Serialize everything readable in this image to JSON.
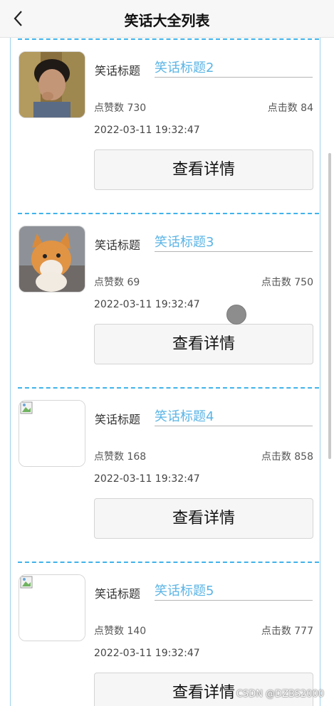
{
  "header": {
    "title": "笑话大全列表",
    "back_icon": "chevron-left-icon"
  },
  "list": {
    "items": [
      {
        "title_label": "笑话标题",
        "title": "笑话标题2",
        "likes": "点赞数 730",
        "clicks": "点击数 84",
        "date": "2022-03-11 19:32:47",
        "button": "查看详情",
        "image": "boy-photo"
      },
      {
        "title_label": "笑话标题",
        "title": "笑话标题3",
        "likes": "点赞数 69",
        "clicks": "点击数 750",
        "date": "2022-03-11 19:32:47",
        "button": "查看详情",
        "image": "cat-photo"
      },
      {
        "title_label": "笑话标题",
        "title": "笑话标题4",
        "likes": "点赞数 168",
        "clicks": "点击数 858",
        "date": "2022-03-11 19:32:47",
        "button": "查看详情",
        "image": "broken-image-icon"
      },
      {
        "title_label": "笑话标题",
        "title": "笑话标题5",
        "likes": "点赞数 140",
        "clicks": "点击数 777",
        "date": "2022-03-11 19:32:47",
        "button": "查看详情",
        "image": "broken-image-icon"
      }
    ]
  },
  "watermark": "CSDN @DZBS2000",
  "colors": {
    "accent": "#5bb4e5",
    "divider": "#40b3ea"
  }
}
